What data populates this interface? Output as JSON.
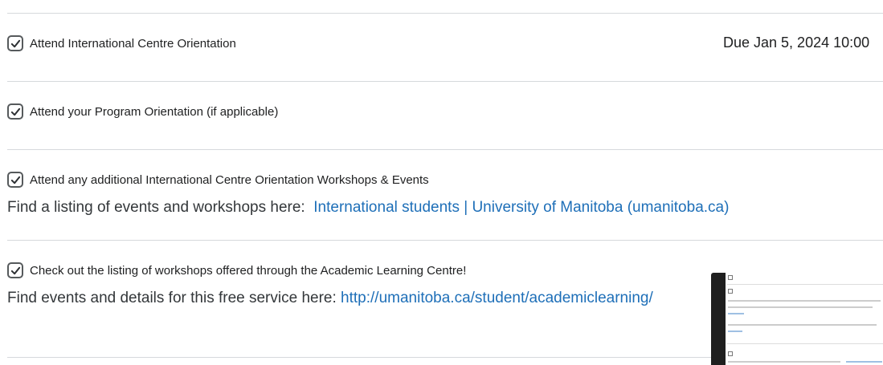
{
  "tasks": [
    {
      "label": "Attend International Centre Orientation",
      "checked": true,
      "due": "Due Jan 5, 2024 10:00"
    },
    {
      "label": "Attend your Program Orientation (if applicable)",
      "checked": true
    },
    {
      "label": "Attend any additional International Centre Orientation Workshops & Events",
      "checked": true,
      "detail_text": "Find a listing of events and workshops here:",
      "detail_link": "International students | University of Manitoba (umanitoba.ca)"
    },
    {
      "label": "Check out the listing of workshops offered through the Academic Learning Centre!",
      "checked": true,
      "detail_text": "Find events and details for this free service here:",
      "detail_link": "http://umanitoba.ca/student/academiclearning/"
    }
  ],
  "colors": {
    "link": "#1e6fb8",
    "divider": "#d6d9dc",
    "checkbox_border": "#565a5c"
  },
  "icons": {
    "checkbox": "checkmark-icon"
  }
}
